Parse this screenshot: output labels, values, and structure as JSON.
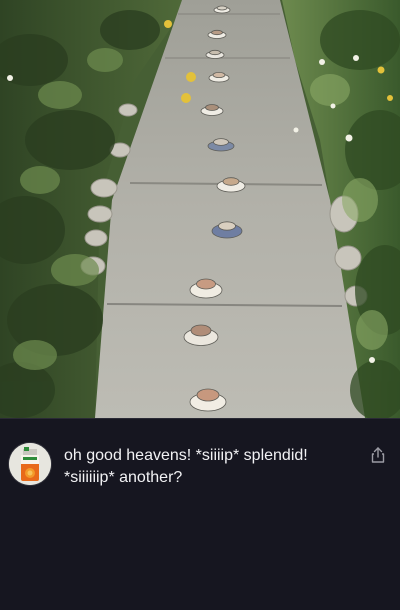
{
  "post": {
    "caption": "oh good heavens! *siiiip* splendid! *siiiiiip* another?",
    "avatar_icon": "juice-carton-avatar-icon",
    "share_icon": "share-icon"
  },
  "colors": {
    "background": "#161620",
    "caption_text": "#f2f2f4",
    "path_concrete": "#b7b6ae",
    "foliage": "#4f6a3a"
  }
}
